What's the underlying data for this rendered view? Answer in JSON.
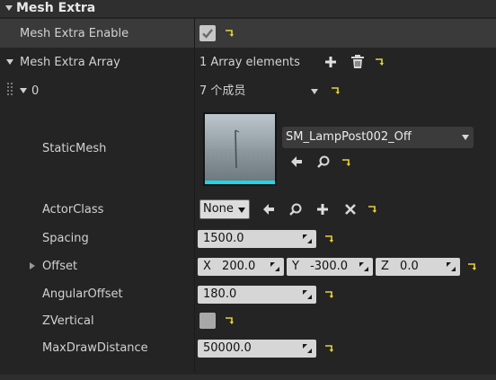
{
  "header": {
    "title": "Mesh Extra"
  },
  "enable_row": {
    "label": "Mesh Extra Enable",
    "checked": true
  },
  "array_row": {
    "label": "Mesh Extra Array",
    "count_text": "1 Array elements"
  },
  "element_row": {
    "index": "0",
    "members_text": "7 个成员"
  },
  "static_mesh": {
    "label": "StaticMesh",
    "value": "SM_LampPost002_Off"
  },
  "actor_class": {
    "label": "ActorClass",
    "value": "None"
  },
  "spacing": {
    "label": "Spacing",
    "value": "1500.0"
  },
  "offset": {
    "label": "Offset",
    "x_label": "X",
    "x_value": "200.0",
    "y_label": "Y",
    "y_value": "-300.0",
    "z_label": "Z",
    "z_value": "0.0"
  },
  "angular_offset": {
    "label": "AngularOffset",
    "value": "180.0"
  },
  "z_vertical": {
    "label": "ZVertical",
    "checked": false
  },
  "max_draw_distance": {
    "label": "MaxDrawDistance",
    "value": "50000.0"
  },
  "colors": {
    "background": "#242424",
    "header": "#2f2f2f",
    "reset_arrow": "#e6d23a",
    "thumbnail_underline": "#19d8e8"
  },
  "icons": [
    "collapse-arrow-icon",
    "checkmark-icon",
    "reset-to-default-icon",
    "add-icon",
    "trash-icon",
    "drag-handle-icon",
    "dropdown-arrow-icon",
    "use-selected-arrow-icon",
    "browse-search-icon",
    "clear-x-icon",
    "spin-drag-icon",
    "expand-arrow-icon"
  ]
}
